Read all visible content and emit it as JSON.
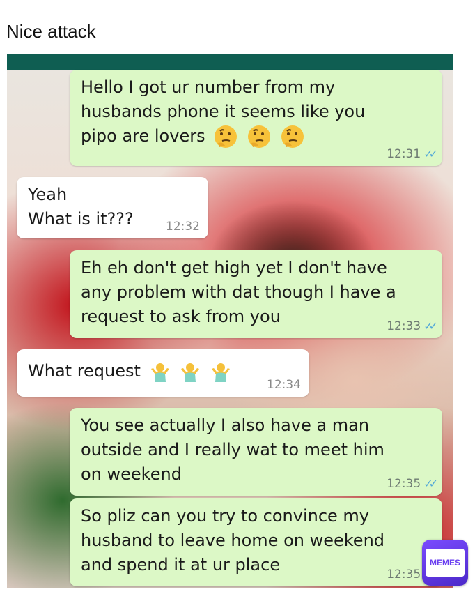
{
  "caption": "Nice attack",
  "chat": {
    "messages": [
      {
        "direction": "outgoing",
        "text": "Hello I got ur number from my\nhusbands phone it seems like you\npipo are lovers",
        "emoji": "thinking-face-icon",
        "emoji_count": 3,
        "time": "12:31",
        "read": true
      },
      {
        "direction": "incoming",
        "text": "Yeah\nWhat is it???",
        "time": "12:32"
      },
      {
        "direction": "outgoing",
        "text": "Eh eh don't get high yet I don't have\nany problem with dat though I have a\nrequest to ask from you",
        "time": "12:33",
        "read": true
      },
      {
        "direction": "incoming",
        "text": "What request",
        "emoji": "person-shrugging-icon",
        "emoji_count": 3,
        "time": "12:34"
      },
      {
        "direction": "outgoing",
        "text": "You see actually I also have a man\noutside and I really wat to meet him\non weekend",
        "time": "12:35",
        "read": true
      },
      {
        "direction": "outgoing",
        "text": "So pliz can you try to convince my\nhusband to leave home on weekend\nand spend it at ur place",
        "time": "12:35",
        "read": true
      }
    ]
  },
  "watermark": {
    "label": "MEMES"
  },
  "colors": {
    "outgoing_bubble": "#dcf8c6",
    "incoming_bubble": "#ffffff",
    "read_ticks": "#4fa6d8",
    "header_bar": "#0f5e52",
    "watermark": "#6a3ff0"
  }
}
